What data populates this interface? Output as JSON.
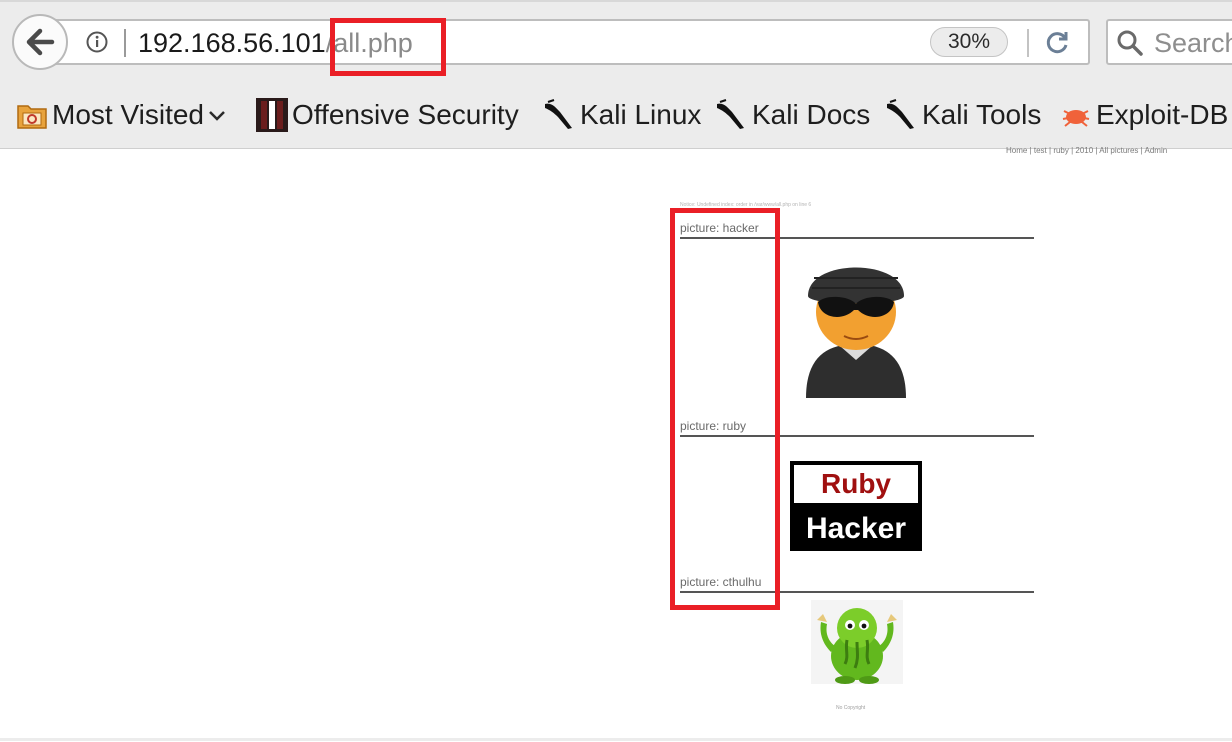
{
  "browser": {
    "url_host": "192.168.56.101",
    "url_path": "/all.php",
    "zoom": "30%",
    "search_placeholder": "Search"
  },
  "bookmarks": [
    {
      "label": "Most Visited",
      "icon": "most-visited-icon"
    },
    {
      "label": "Offensive Security",
      "icon": "offensive-security-icon"
    },
    {
      "label": "Kali Linux",
      "icon": "kali-dragon-icon"
    },
    {
      "label": "Kali Docs",
      "icon": "kali-dragon-icon"
    },
    {
      "label": "Kali Tools",
      "icon": "kali-dragon-icon"
    },
    {
      "label": "Exploit-DB",
      "icon": "exploit-db-icon"
    }
  ],
  "page": {
    "nav": [
      "Home",
      "test",
      "ruby",
      "2010",
      "All pictures",
      "Admin"
    ],
    "notice": "Notice: Undefined index: order in /var/www/all.php on line 6",
    "pictures": [
      {
        "label": "picture: hacker",
        "image": "hacker-avatar"
      },
      {
        "label": "picture: ruby",
        "image": "ruby-hacker-logo"
      },
      {
        "label": "picture: cthulhu",
        "image": "cthulhu-cartoon"
      }
    ],
    "ruby_logo_top": "Ruby",
    "ruby_logo_bottom": "Hacker",
    "copyright": "No Copyright"
  }
}
